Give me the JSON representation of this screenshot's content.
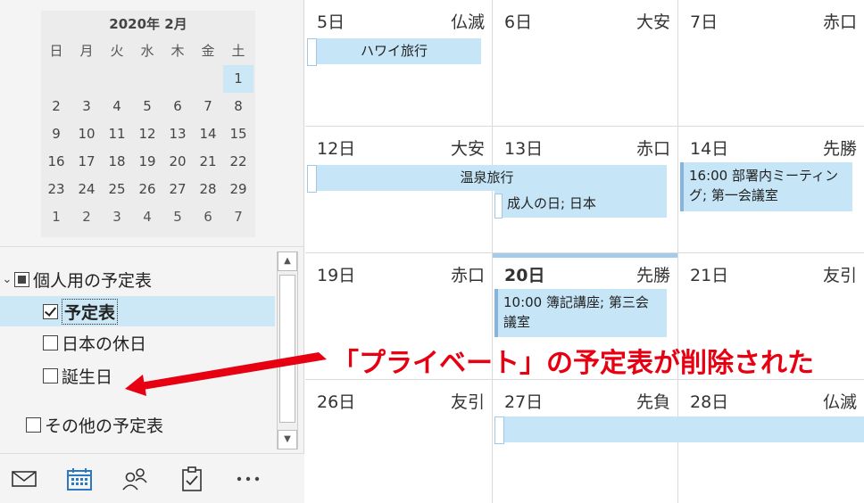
{
  "mini_calendar": {
    "title": "2020年 2月",
    "weekdays": [
      "日",
      "月",
      "火",
      "水",
      "木",
      "金",
      "土"
    ],
    "weeks": [
      [
        "",
        "",
        "",
        "",
        "",
        "",
        "1"
      ],
      [
        "2",
        "3",
        "4",
        "5",
        "6",
        "7",
        "8"
      ],
      [
        "9",
        "10",
        "11",
        "12",
        "13",
        "14",
        "15"
      ],
      [
        "16",
        "17",
        "18",
        "19",
        "20",
        "21",
        "22"
      ],
      [
        "23",
        "24",
        "25",
        "26",
        "27",
        "28",
        "29"
      ],
      [
        "1",
        "2",
        "3",
        "4",
        "5",
        "6",
        "7"
      ]
    ]
  },
  "calendar_tree": {
    "group_personal": "個人用の予定表",
    "item_schedule": "予定表",
    "item_japan_holidays": "日本の休日",
    "item_birthdays": "誕生日",
    "group_other": "その他の予定表"
  },
  "nav_icons": [
    "mail-icon",
    "calendar-icon",
    "people-icon",
    "tasks-icon",
    "more-icon"
  ],
  "grid": {
    "weeks": [
      [
        {
          "day": "5日",
          "rokuyo": "仏滅"
        },
        {
          "day": "6日",
          "rokuyo": "大安"
        },
        {
          "day": "7日",
          "rokuyo": "赤口"
        }
      ],
      [
        {
          "day": "12日",
          "rokuyo": "大安"
        },
        {
          "day": "13日",
          "rokuyo": "赤口"
        },
        {
          "day": "14日",
          "rokuyo": "先勝"
        }
      ],
      [
        {
          "day": "19日",
          "rokuyo": "赤口"
        },
        {
          "day": "20日",
          "rokuyo": "先勝"
        },
        {
          "day": "21日",
          "rokuyo": "友引"
        }
      ],
      [
        {
          "day": "26日",
          "rokuyo": "友引"
        },
        {
          "day": "27日",
          "rokuyo": "先負"
        },
        {
          "day": "28日",
          "rokuyo": "仏滅"
        }
      ]
    ],
    "events": {
      "hawaii": "ハワイ旅行",
      "onsen": "温泉旅行",
      "seijin": "成人の日; 日本",
      "meeting": "16:00 部署内ミーティング; 第一会議室",
      "boki": "10:00 簿記講座; 第三会議室"
    }
  },
  "annotation": "「プライベート」の予定表が削除された",
  "colors": {
    "event_bg": "#c6e5f7",
    "selected_bg": "#cce8f6",
    "annotation": "#e60012",
    "nav_active": "#2b79c2"
  }
}
